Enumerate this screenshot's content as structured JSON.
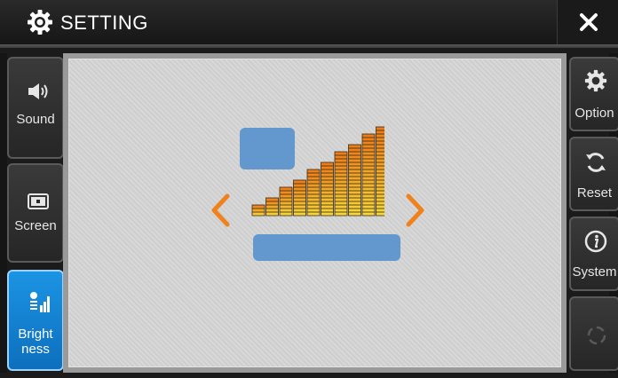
{
  "header": {
    "title": "SETTING",
    "icon": "gear-icon",
    "close_icon": "close-icon"
  },
  "left_tabs": [
    {
      "label": "Sound",
      "icon": "speaker-icon",
      "active": false
    },
    {
      "label": "Screen",
      "icon": "screen-icon",
      "active": false
    },
    {
      "label_line1": "Bright",
      "label_line2": "ness",
      "icon": "brightness-icon",
      "active": true
    }
  ],
  "right_buttons": [
    {
      "label": "Option",
      "icon": "gear-icon"
    },
    {
      "label": "Reset",
      "icon": "refresh-icon"
    },
    {
      "label": "System",
      "icon": "info-icon"
    },
    {
      "label": "",
      "icon": "loading-icon"
    }
  ],
  "brightness": {
    "level_bars": 10,
    "prev_icon": "chevron-left-icon",
    "next_icon": "chevron-right-icon"
  },
  "colors": {
    "active_tab": "#1b94e3",
    "arrow": "#f0821e",
    "placeholder": "#6298cd"
  }
}
